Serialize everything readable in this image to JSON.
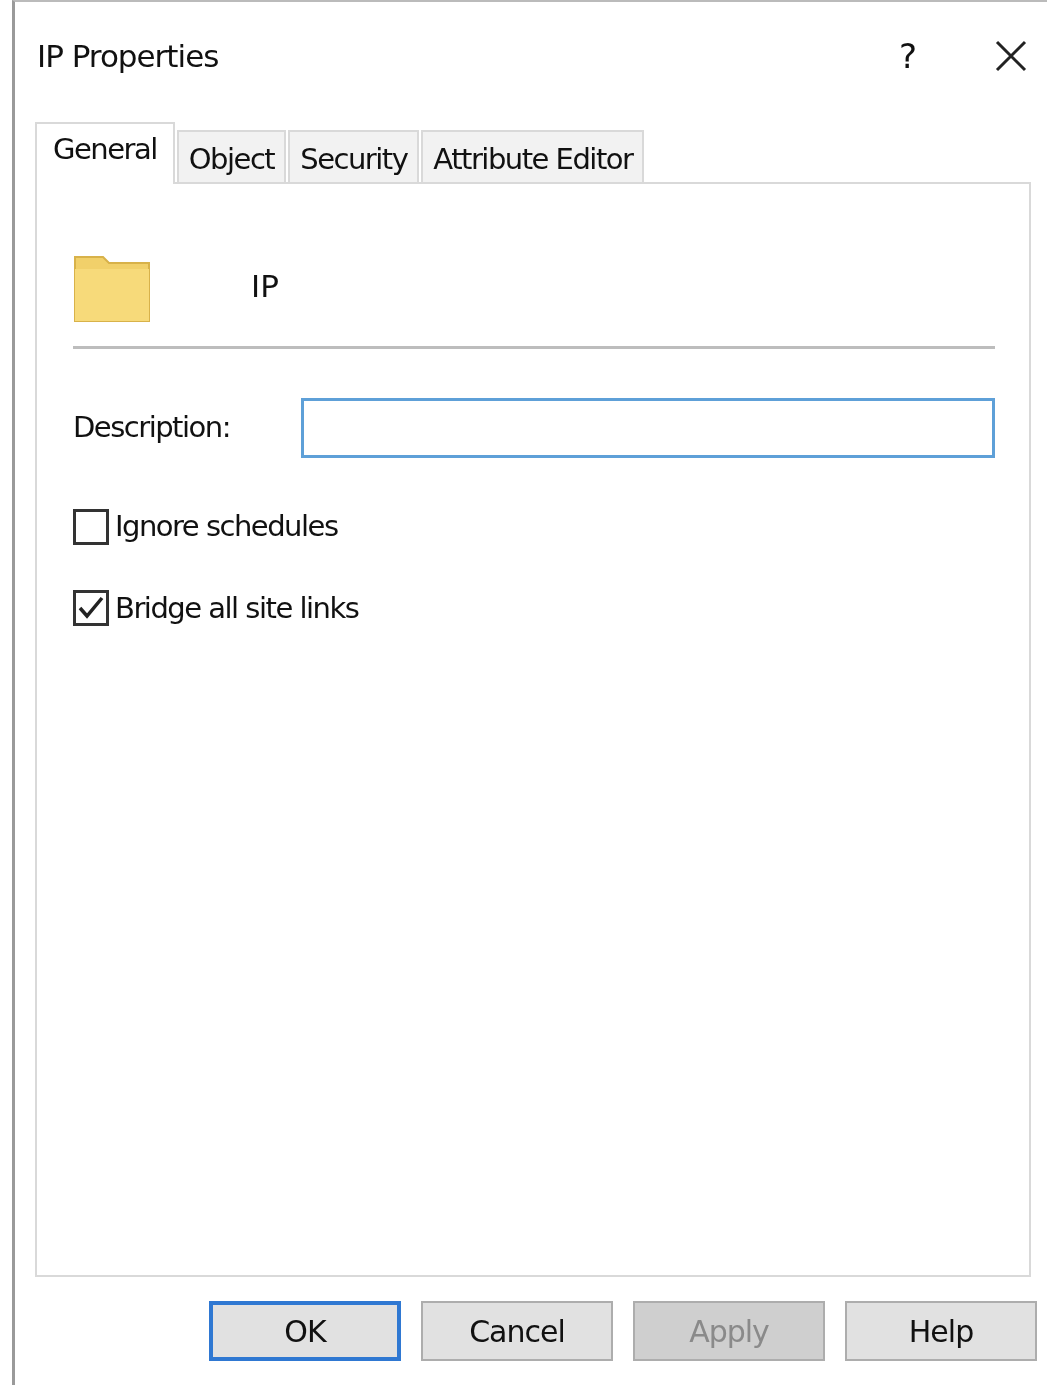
{
  "window": {
    "title": "IP Properties",
    "help_glyph": "?"
  },
  "tabs": [
    {
      "label": "General",
      "selected": true
    },
    {
      "label": "Object",
      "selected": false
    },
    {
      "label": "Security",
      "selected": false
    },
    {
      "label": "Attribute Editor",
      "selected": false
    }
  ],
  "object": {
    "name": "IP"
  },
  "description": {
    "label": "Description:",
    "focused": true
  },
  "checkboxes": [
    {
      "label": "Ignore schedules",
      "checked": false
    },
    {
      "label": "Bridge all site links",
      "checked": true
    }
  ],
  "buttons": [
    {
      "label": "OK",
      "default": true,
      "disabled": false
    },
    {
      "label": "Cancel",
      "default": false,
      "disabled": false
    },
    {
      "label": "Apply",
      "default": false,
      "disabled": true
    },
    {
      "label": "Help",
      "default": false,
      "disabled": false
    }
  ]
}
